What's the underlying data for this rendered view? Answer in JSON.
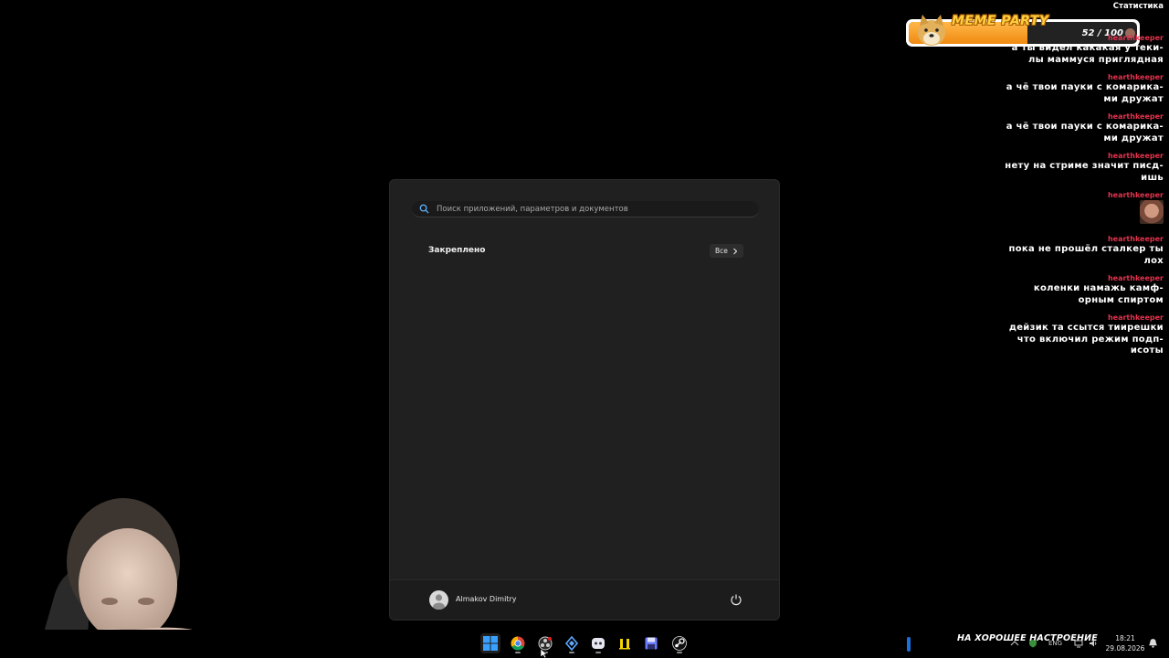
{
  "start_menu": {
    "search_placeholder": "Поиск приложений, параметров и документов",
    "pinned_title": "Закреплено",
    "all_button_label": "Все",
    "user_name": "Almakov Dimitry"
  },
  "overlay": {
    "stats_label": "Статистика",
    "meme_party": {
      "title": "MEME PARTY",
      "count": "52 / 100",
      "progress": 0.52
    },
    "chat": [
      {
        "user": "hearthkeeper",
        "text": "а ты видел какакая у теки-\nлы маммуся приглядная"
      },
      {
        "user": "hearthkeeper",
        "text": "а чё твои пауки с комарика-\nми дружат"
      },
      {
        "user": "hearthkeeper",
        "text": "а чё твои пауки с комарика-\nми дружат"
      },
      {
        "user": "hearthkeeper",
        "text": "нету на стриме значит писд-\nишь"
      },
      {
        "user": "hearthkeeper",
        "text": ""
      },
      {
        "user": "hearthkeeper",
        "text": "пока не прошёл сталкер ты\nлох"
      },
      {
        "user": "hearthkeeper",
        "text": "коленки намажь камф-\nорным спиртом"
      },
      {
        "user": "hearthkeeper",
        "text": "дейзик та ссытся тиирешки\nчто включил режим подп-\nисоты"
      }
    ]
  },
  "taskbar": {
    "icons": [
      "windows-start-icon",
      "chrome-icon",
      "obs-icon",
      "vpn-icon",
      "discord-icon",
      "notes-icon",
      "save-icon",
      "steam-icon"
    ],
    "banner_text": "НА ХОРОШЕЕ НАСТРОЕНИЕ",
    "language": "ENG",
    "time": "18:21",
    "date": "29.08.2026"
  },
  "colors": {
    "chat_username": "#e0334d",
    "start_menu_bg": "#202020",
    "meme_party_fill": "#f08a10"
  }
}
